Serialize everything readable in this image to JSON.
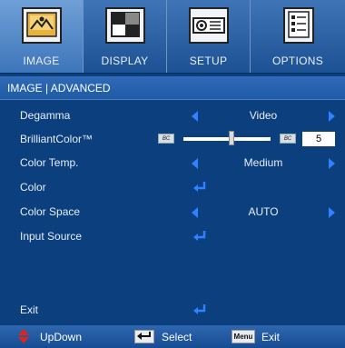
{
  "tabs": [
    {
      "label": "IMAGE",
      "icon": "image-icon",
      "active": true
    },
    {
      "label": "DISPLAY",
      "icon": "display-icon",
      "active": false
    },
    {
      "label": "SETUP",
      "icon": "projector-icon",
      "active": false
    },
    {
      "label": "OPTIONS",
      "icon": "options-list-icon",
      "active": false
    }
  ],
  "header": {
    "title": "IMAGE | ADVANCED"
  },
  "menu": {
    "degamma": {
      "label": "Degamma",
      "value": "Video"
    },
    "brilliantcolor": {
      "label": "BrilliantColor™",
      "value": "5",
      "level_fraction": 0.55,
      "min_icon_text": "BC",
      "max_icon_text": "BC"
    },
    "color_temp": {
      "label": "Color Temp.",
      "value": "Medium"
    },
    "color": {
      "label": "Color"
    },
    "color_space": {
      "label": "Color Space",
      "value": "AUTO"
    },
    "input_source": {
      "label": "Input Source"
    },
    "exit": {
      "label": "Exit"
    }
  },
  "footer": {
    "updown_label": "UpDown",
    "select_label": "Select",
    "menu_key_text": "Menu",
    "exit_label": "Exit"
  },
  "colors": {
    "background": "#0b3f7d",
    "tab_bar": "#1c5294",
    "active_tab": "#5a8cc9",
    "arrow": "#2e82ff",
    "updown_icon": "#e2231a"
  }
}
